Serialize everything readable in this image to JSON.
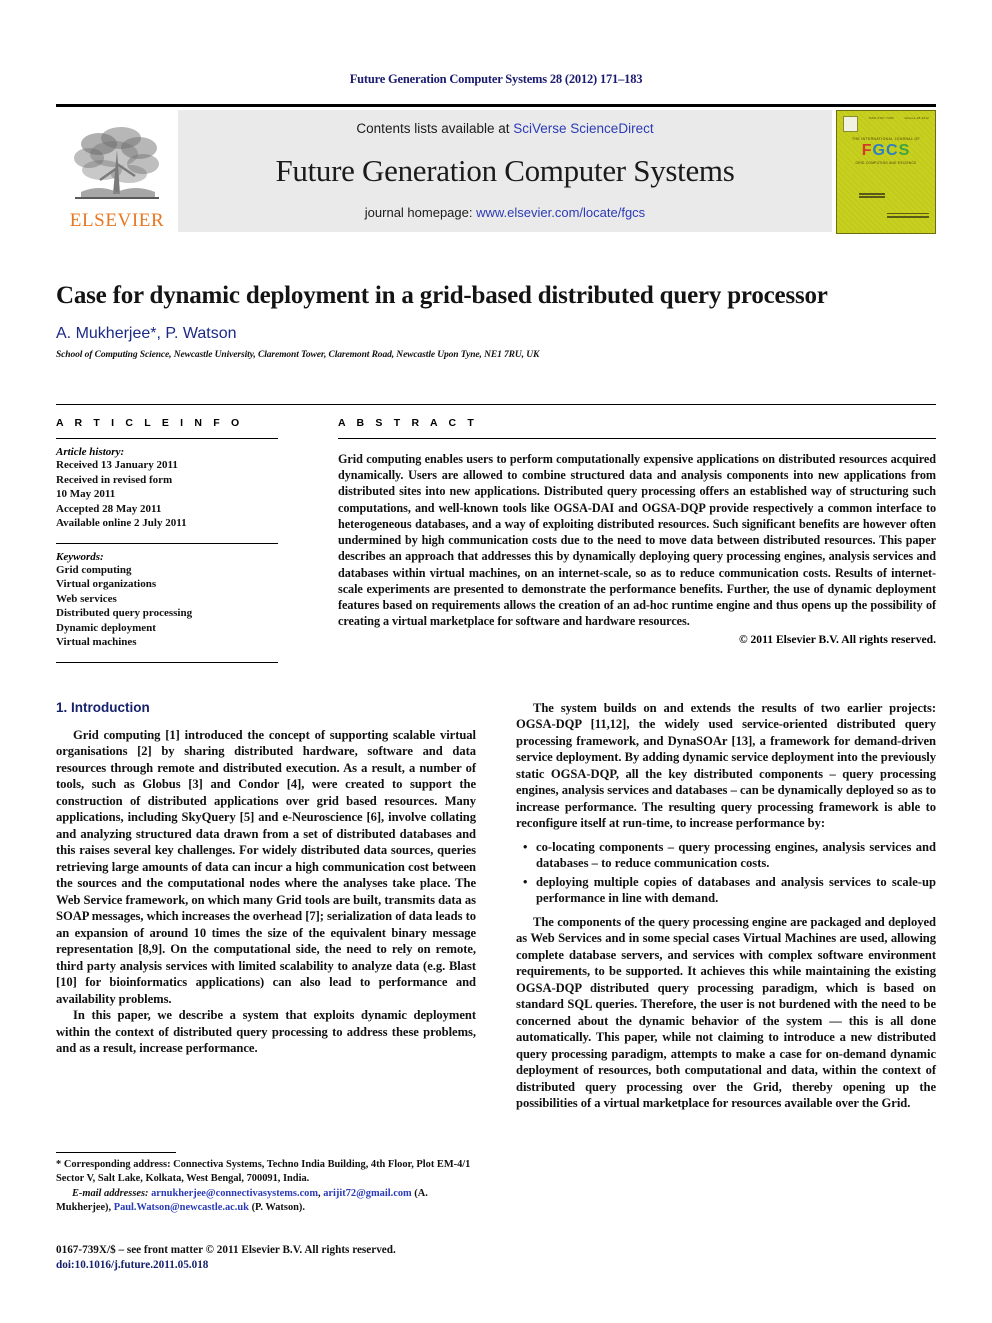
{
  "running_head": "Future Generation Computer Systems 28 (2012) 171–183",
  "masthead": {
    "publisher_logo_text": "ELSEVIER",
    "contents_prefix": "Contents lists available at ",
    "contents_link": "SciVerse ScienceDirect",
    "journal_title": "Future Generation Computer Systems",
    "homepage_prefix": "journal homepage: ",
    "homepage_link": "www.elsevier.com/locate/fgcs",
    "cover": {
      "top_left_label": "ELSEVIER",
      "top_center_label": "ISSN 0167-739X",
      "top_right_label": "Volume 28  2012",
      "tagline": "THE INTERNATIONAL JOURNAL OF",
      "acronym_letters": [
        "F",
        "G",
        "C",
        "S"
      ],
      "subtitle": "GRID COMPUTING AND ESCIENCE",
      "footer_label": "ScienceDirect"
    }
  },
  "article": {
    "title": "Case for dynamic deployment in a grid-based distributed query processor",
    "authors": "A. Mukherjee*, P. Watson",
    "affiliation": "School of Computing Science, Newcastle University, Claremont Tower, Claremont Road, Newcastle Upon Tyne, NE1 7RU, UK"
  },
  "article_info": {
    "kicker": "A R T I C L E    I N F O",
    "history_label": "Article history:",
    "history": [
      "Received 13 January 2011",
      "Received in revised form",
      "10 May 2011",
      "Accepted 28 May 2011",
      "Available online 2 July 2011"
    ],
    "keywords_label": "Keywords:",
    "keywords": [
      "Grid computing",
      "Virtual organizations",
      "Web services",
      "Distributed query processing",
      "Dynamic deployment",
      "Virtual machines"
    ]
  },
  "abstract": {
    "kicker": "A B S T R A C T",
    "text": "Grid computing enables users to perform computationally expensive applications on distributed resources acquired dynamically. Users are allowed to combine structured data and analysis components into new applications from distributed sites into new applications. Distributed query processing offers an established way of structuring such computations, and well-known tools like OGSA-DAI and OGSA-DQP provide respectively a common interface to heterogeneous databases, and a way of exploiting distributed resources. Such significant benefits are however often undermined by high communication costs due to the need to move data between distributed resources. This paper describes an approach that addresses this by dynamically deploying query processing engines, analysis services and databases within virtual machines, on an internet-scale, so as to reduce communication costs. Results of internet-scale experiments are presented to demonstrate the performance benefits. Further, the use of dynamic deployment features based on requirements allows the creation of an ad-hoc runtime engine and thus opens up the possibility of creating a virtual marketplace for software and hardware resources.",
    "copyright": "© 2011 Elsevier B.V. All rights reserved."
  },
  "body": {
    "section_heading": "1. Introduction",
    "left_paragraph_1_pre": "Grid computing [",
    "left_paragraph_1": {
      "p1": "Grid computing [1] introduced the concept of supporting scalable virtual organisations [2] by sharing distributed hardware, software and data resources through remote and distributed execution. As a result, a number of tools, such as Globus [3] and Condor [4], were created to support the construction of distributed applications over grid based resources. Many applications, including SkyQuery [5] and e-Neuroscience [6], involve collating and analyzing structured data drawn from a set of distributed databases and this raises several key challenges. For widely distributed data sources, queries retrieving large amounts of data can incur a high communication cost between the sources and the computational nodes where the analyses take place. The Web Service framework, on which many Grid tools are built, transmits data as SOAP messages, which increases the overhead [7]; serialization of data leads to an expansion of around 10 times the size of the equivalent binary message representation [8,9]. On the computational side, the need to rely on remote, third party analysis services with limited scalability to analyze data (e.g. Blast [10] for bioinformatics applications) can also lead to performance and availability problems.",
      "p2": "In this paper, we describe a system that exploits dynamic deployment within the context of distributed query processing to address these problems, and as a result, increase performance."
    },
    "right_paragraph_1": "The system builds on and extends the results of two earlier projects: OGSA-DQP [11,12], the widely used service-oriented distributed query processing framework, and DynaSOAr [13], a framework for demand-driven service deployment. By adding dynamic service deployment into the previously static OGSA-DQP, all the key distributed components – query processing engines, analysis services and databases – can be dynamically deployed so as to increase performance. The resulting query processing framework is able to reconfigure itself at run-time, to increase performance by:",
    "bullets": [
      "co-locating components – query processing engines, analysis services and databases – to reduce communication costs.",
      "deploying multiple copies of databases and analysis services to scale-up performance in line with demand."
    ],
    "right_paragraph_2": "The components of the query processing engine are packaged and deployed as Web Services and in some special cases Virtual Machines are used, allowing complete database servers, and services with complex software environment requirements, to be supported. It achieves this while maintaining the existing OGSA-DQP distributed query processing paradigm, which is based on standard SQL queries. Therefore, the user is not burdened with the need to be concerned about the dynamic behavior of the system — this is all done automatically. This paper, while not claiming to introduce a new distributed query processing paradigm, attempts to make a case for on-demand dynamic deployment of resources, both computational and data, within the context of distributed query processing over the Grid, thereby opening up the possibilities of a virtual marketplace for resources available over the Grid."
  },
  "footnotes": {
    "corresponding_marker": "*",
    "corresponding": "Corresponding address: Connectiva Systems, Techno India Building, 4th Floor, Plot EM-4/1 Sector V, Salt Lake, Kolkata, West Bengal, 700091, India.",
    "email_label": "E-mail addresses:",
    "email_1": "arnukherjee@connectivasystems.com",
    "email_2": "arijit72@gmail.com",
    "email_1_owner": "(A. Mukherjee),",
    "email_3": "Paul.Watson@newcastle.ac.uk",
    "email_3_owner": "(P. Watson)."
  },
  "imprint": {
    "issn_line": "0167-739X/$ – see front matter © 2011 Elsevier B.V. All rights reserved.",
    "doi": "doi:10.1016/j.future.2011.05.018"
  },
  "colors": {
    "link": "#2b3bb5",
    "heading_navy": "#16226b",
    "author_navy": "#1a2a86",
    "elsevier_orange": "#e87722",
    "cover_yellow": "#c7cf1f",
    "band_gray": "#eaeaea"
  }
}
